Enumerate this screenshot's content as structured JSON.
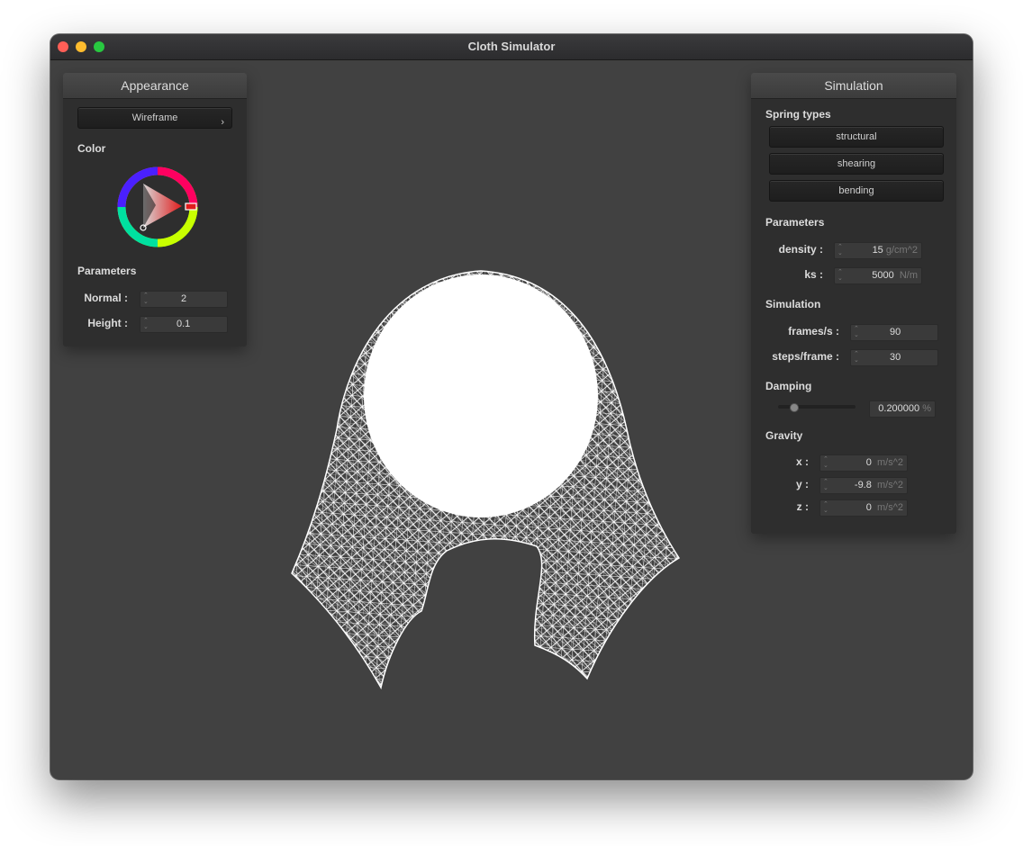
{
  "window": {
    "title": "Cloth Simulator"
  },
  "appearance": {
    "title": "Appearance",
    "shader_select": "Wireframe",
    "color_label": "Color",
    "color_value": "#e01c1c",
    "parameters_label": "Parameters",
    "normal_label": "Normal :",
    "normal_value": "2",
    "height_label": "Height :",
    "height_value": "0.1"
  },
  "simulation": {
    "title": "Simulation",
    "spring_types_label": "Spring types",
    "spring_buttons": [
      "structural",
      "shearing",
      "bending"
    ],
    "parameters_label": "Parameters",
    "density_label": "density :",
    "density_value": "15",
    "density_unit": "g/cm^2",
    "ks_label": "ks :",
    "ks_value": "5000",
    "ks_unit": "N/m",
    "simulation_label": "Simulation",
    "fps_label": "frames/s :",
    "fps_value": "90",
    "steps_label": "steps/frame :",
    "steps_value": "30",
    "damping_label": "Damping",
    "damping_fraction": 0.2,
    "damping_value": "0.200000",
    "damping_unit": "%",
    "gravity_label": "Gravity",
    "gravity_x_label": "x :",
    "gravity_x_value": "0",
    "gravity_y_label": "y :",
    "gravity_y_value": "-9.8",
    "gravity_z_label": "z :",
    "gravity_z_value": "0",
    "gravity_unit": "m/s^2"
  },
  "colors": {
    "background": "#414141",
    "panel": "#2e2e2e",
    "mesh": "#ffffff"
  }
}
